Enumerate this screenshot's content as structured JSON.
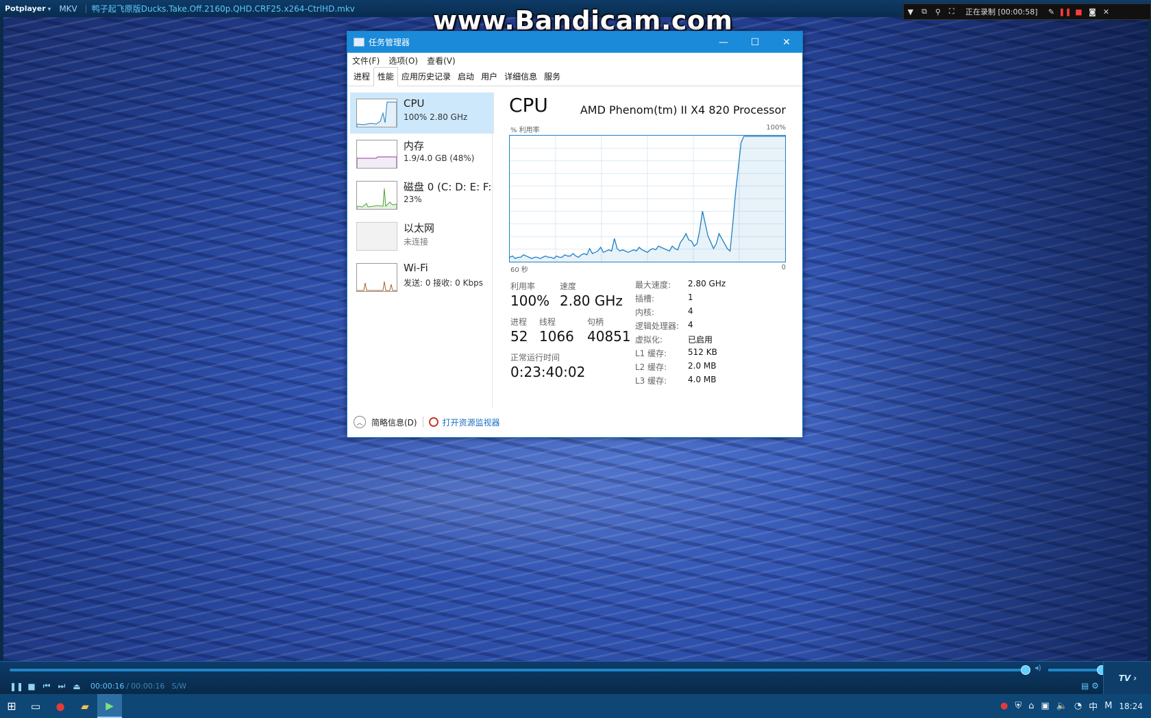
{
  "potplayer": {
    "brand": "Potplayer",
    "format": "MKV",
    "filename": "鸭子起飞原版Ducks.Take.Off.2160p.QHD.CRF25.x264-CtrlHD.mkv",
    "controls": {
      "time_current": "00:00:16",
      "time_total": "00:00:16",
      "divider": "/",
      "render_mode": "S/W",
      "tv_label": "TV ›",
      "seek_position": 0.99,
      "volume_level": 0.92
    }
  },
  "bandicam": {
    "watermark": "www.Bandicam.com",
    "status": "正在录制 [00:00:58]"
  },
  "task_manager": {
    "title": "任务管理器",
    "menu": [
      "文件(F)",
      "选项(O)",
      "查看(V)"
    ],
    "tabs": [
      "进程",
      "性能",
      "应用历史记录",
      "启动",
      "用户",
      "详细信息",
      "服务"
    ],
    "active_tab": "性能",
    "sidebar": [
      {
        "name": "CPU",
        "sub": "100% 2.80 GHz",
        "color": "#1d7fc0",
        "selected": true
      },
      {
        "name": "内存",
        "sub": "1.9/4.0 GB (48%)",
        "color": "#8b3a9c"
      },
      {
        "name": "磁盘 0 (C: D: E: F:",
        "sub": "23%",
        "color": "#4da534"
      },
      {
        "name": "以太网",
        "sub": "未连接",
        "color": "#aaaaaa"
      },
      {
        "name": "Wi-Fi",
        "sub": "发送: 0 接收: 0 Kbps",
        "color": "#a8632b"
      }
    ],
    "cpu": {
      "heading": "CPU",
      "model": "AMD Phenom(tm) II X4 820 Processor",
      "axis_label": "% 利用率",
      "axis_max": "100%",
      "axis_time": "60 秒",
      "axis_zero": "0",
      "utilization_label": "利用率",
      "utilization": "100%",
      "speed_label": "速度",
      "speed": "2.80 GHz",
      "processes_label": "进程",
      "processes": "52",
      "threads_label": "线程",
      "threads": "1066",
      "handles_label": "句柄",
      "handles": "40851",
      "uptime_label": "正常运行时间",
      "uptime": "0:23:40:02",
      "specs": [
        {
          "k": "最大速度:",
          "v": "2.80 GHz"
        },
        {
          "k": "插槽:",
          "v": "1"
        },
        {
          "k": "内核:",
          "v": "4"
        },
        {
          "k": "逻辑处理器:",
          "v": "4"
        },
        {
          "k": "虚拟化:",
          "v": "已启用"
        },
        {
          "k": "L1 缓存:",
          "v": "512 KB"
        },
        {
          "k": "L2 缓存:",
          "v": "2.0 MB"
        },
        {
          "k": "L3 缓存:",
          "v": "4.0 MB"
        }
      ],
      "history": [
        3,
        4,
        2,
        3,
        3,
        5,
        4,
        3,
        2,
        3,
        3,
        2,
        3,
        4,
        3,
        3,
        2,
        4,
        3,
        3,
        5,
        4,
        4,
        6,
        4,
        3,
        5,
        6,
        5,
        10,
        6,
        7,
        8,
        11,
        7,
        8,
        9,
        8,
        18,
        10,
        8,
        9,
        8,
        7,
        8,
        9,
        8,
        11,
        9,
        8,
        7,
        9,
        10,
        9,
        12,
        11,
        10,
        9,
        8,
        12,
        10,
        9,
        15,
        18,
        22,
        17,
        16,
        12,
        14,
        25,
        40,
        30,
        20,
        15,
        10,
        14,
        22,
        18,
        14,
        10,
        8,
        30,
        55,
        75,
        95,
        100,
        100,
        100,
        100,
        100,
        100,
        100,
        100,
        100,
        100,
        100,
        100,
        100,
        100,
        100,
        100
      ]
    },
    "footer": {
      "fewer_details": "简略信息(D)",
      "open_monitor": "打开资源监视器"
    }
  },
  "taskbar": {
    "clock": "18:24",
    "ime": "中",
    "ime_mode": "M"
  }
}
